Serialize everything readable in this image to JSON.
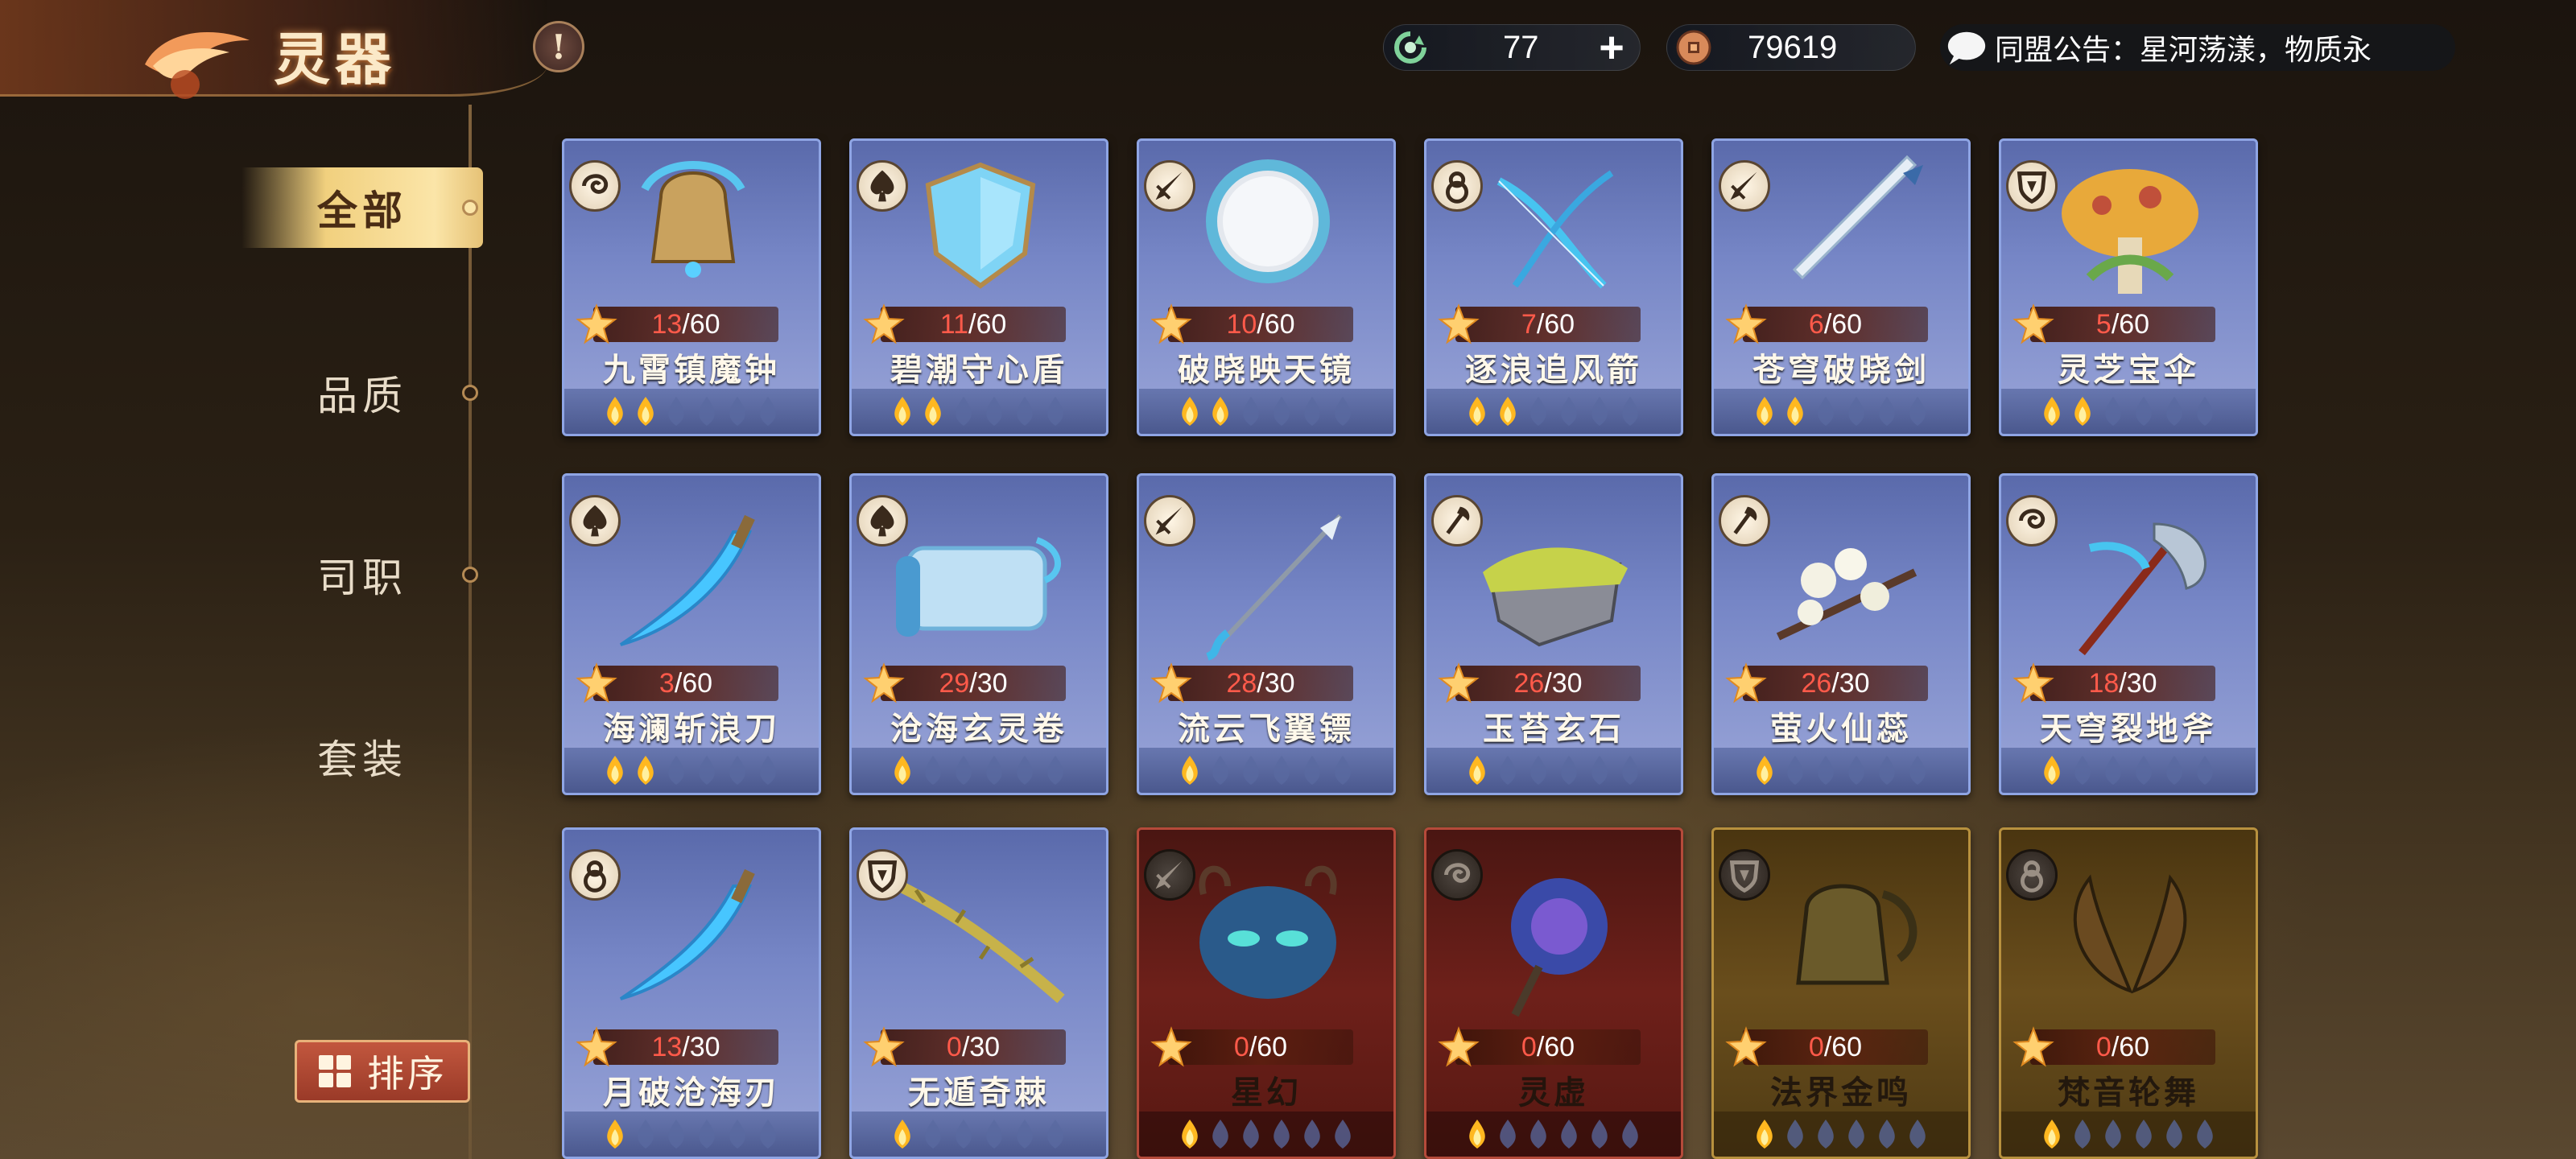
{
  "header": {
    "title": "灵器",
    "info_icon": "!",
    "energy": {
      "icon": "refresh-energy-icon",
      "value": "77",
      "plus": "+"
    },
    "coins": {
      "icon": "coin-icon",
      "value": "79619"
    },
    "notice": {
      "icon": "chat-bubble-icon",
      "text": "同盟公告：星河荡漾，物质永"
    }
  },
  "sidebar": {
    "tabs": [
      {
        "label": "全部",
        "active": true
      },
      {
        "label": "品质",
        "active": false
      },
      {
        "label": "司职",
        "active": false
      },
      {
        "label": "套装",
        "active": false
      }
    ],
    "sort_label": "排序"
  },
  "colors": {
    "blue_card": "#7686c6",
    "red_card": "#6e201a",
    "gold_card": "#6a4e1c",
    "level_current": "#ff5a4a"
  },
  "cards": [
    {
      "name": "九霄镇魔钟",
      "cur": "13",
      "max": "/60",
      "filled": 2,
      "style": "blue",
      "type_icon": "swirl-icon",
      "art": "bell"
    },
    {
      "name": "碧潮守心盾",
      "cur": "11",
      "max": "/60",
      "filled": 2,
      "style": "blue",
      "type_icon": "spade-icon",
      "art": "shield"
    },
    {
      "name": "破晓映天镜",
      "cur": "10",
      "max": "/60",
      "filled": 2,
      "style": "blue",
      "type_icon": "dagger-icon",
      "art": "mirror"
    },
    {
      "name": "逐浪追风箭",
      "cur": "7",
      "max": "/60",
      "filled": 2,
      "style": "blue",
      "type_icon": "gourd-icon",
      "art": "bow"
    },
    {
      "name": "苍穹破晓剑",
      "cur": "6",
      "max": "/60",
      "filled": 2,
      "style": "blue",
      "type_icon": "dagger-icon",
      "art": "sword"
    },
    {
      "name": "灵芝宝伞",
      "cur": "5",
      "max": "/60",
      "filled": 2,
      "style": "blue",
      "type_icon": "shield-crest-icon",
      "art": "mushroom"
    },
    {
      "name": "海澜斩浪刀",
      "cur": "3",
      "max": "/60",
      "filled": 2,
      "style": "blue",
      "type_icon": "spade-icon",
      "art": "blade"
    },
    {
      "name": "沧海玄灵卷",
      "cur": "29",
      "max": "/30",
      "filled": 1,
      "style": "blue",
      "type_icon": "spade-icon",
      "art": "scroll"
    },
    {
      "name": "流云飞翼镖",
      "cur": "28",
      "max": "/30",
      "filled": 1,
      "style": "blue",
      "type_icon": "dagger-icon",
      "art": "spear"
    },
    {
      "name": "玉苔玄石",
      "cur": "26",
      "max": "/30",
      "filled": 1,
      "style": "blue",
      "type_icon": "axe-icon",
      "art": "stone"
    },
    {
      "name": "萤火仙蕊",
      "cur": "26",
      "max": "/30",
      "filled": 1,
      "style": "blue",
      "type_icon": "axe-icon",
      "art": "flower"
    },
    {
      "name": "天穹裂地斧",
      "cur": "18",
      "max": "/30",
      "filled": 1,
      "style": "blue",
      "type_icon": "swirl-icon",
      "art": "axe"
    },
    {
      "name": "月破沧海刃",
      "cur": "13",
      "max": "/30",
      "filled": 1,
      "style": "blue",
      "type_icon": "gourd-icon",
      "art": "blade"
    },
    {
      "name": "无遁奇棘",
      "cur": "0",
      "max": "/30",
      "filled": 1,
      "style": "blue",
      "type_icon": "shield-crest-icon",
      "art": "vine"
    },
    {
      "name": "星幻",
      "cur": "0",
      "max": "/60",
      "filled": 1,
      "style": "red",
      "type_icon": "dagger-icon",
      "art": "mask"
    },
    {
      "name": "灵虚",
      "cur": "0",
      "max": "/60",
      "filled": 1,
      "style": "red",
      "type_icon": "swirl-icon",
      "art": "staff"
    },
    {
      "name": "法界金鸣",
      "cur": "0",
      "max": "/60",
      "filled": 1,
      "style": "gold",
      "type_icon": "shield-crest-icon",
      "art": "bell"
    },
    {
      "name": "梵音轮舞",
      "cur": "0",
      "max": "/60",
      "filled": 1,
      "style": "gold",
      "type_icon": "gourd-icon",
      "art": "wings"
    }
  ]
}
